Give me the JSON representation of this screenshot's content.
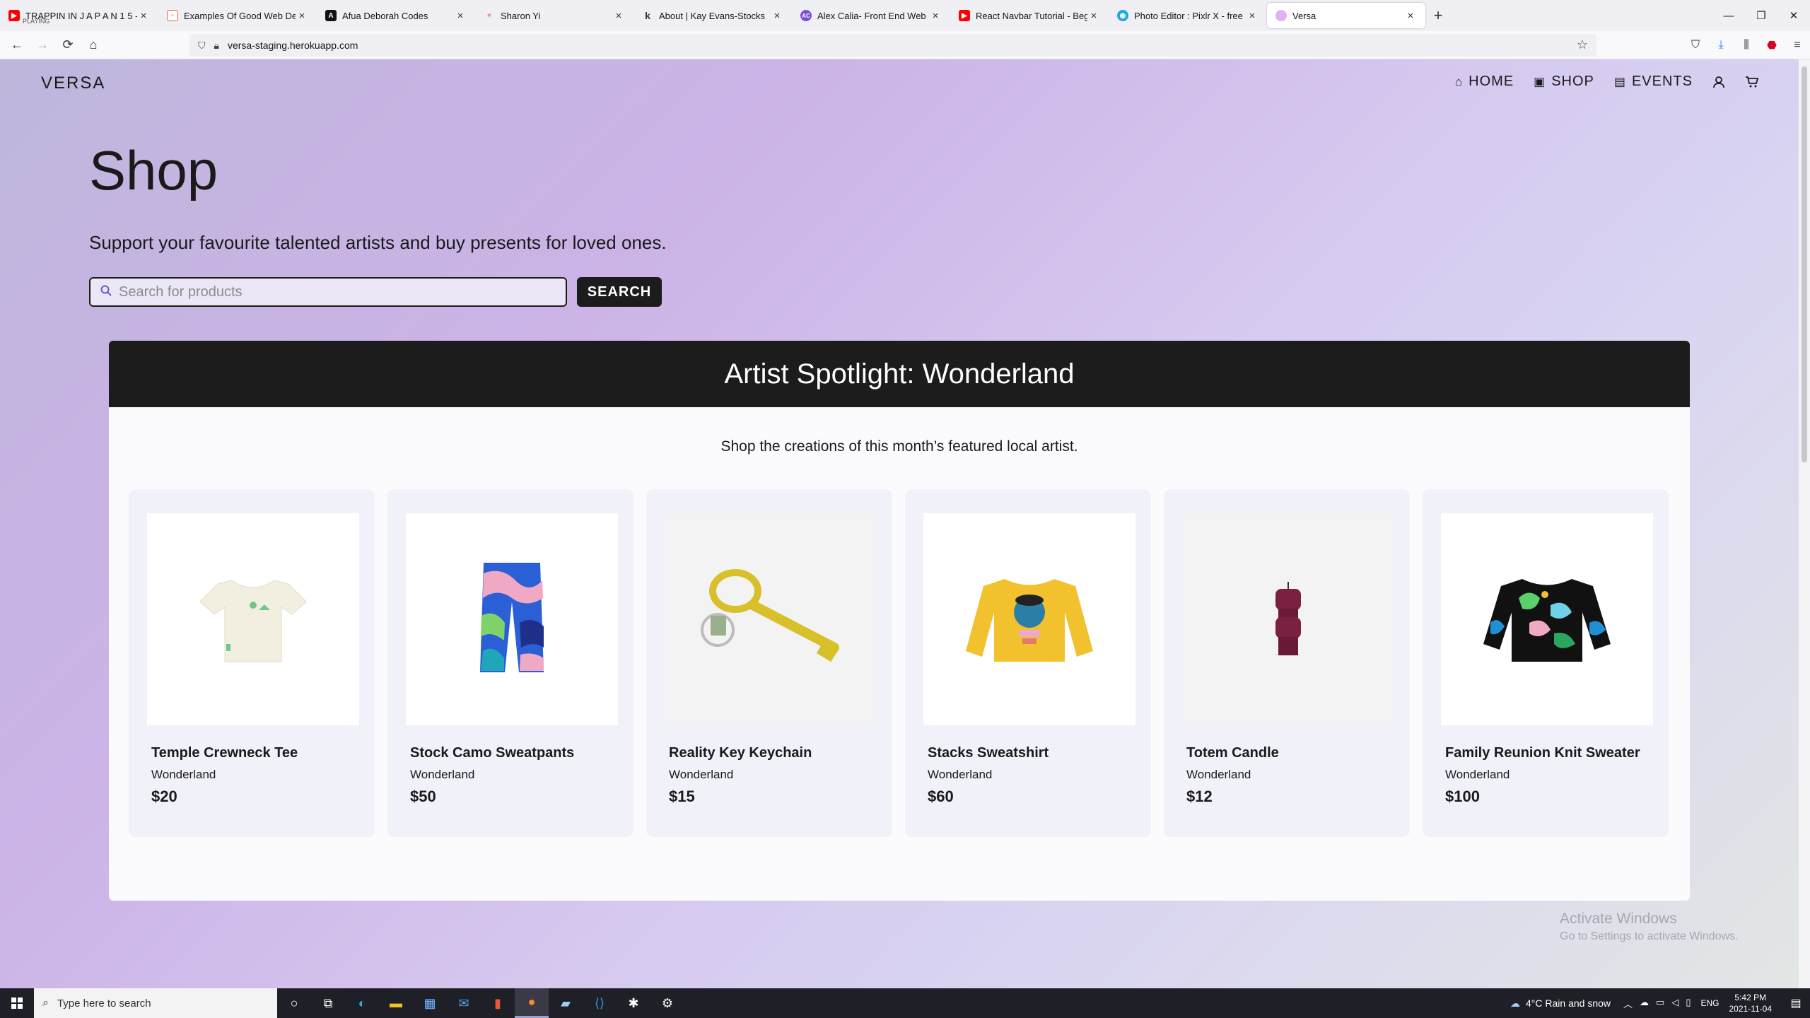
{
  "browser": {
    "tabs": [
      {
        "label": "TRAPPIN IN J A P A N 1 5 -",
        "sub": "PLAYING",
        "fav_color": "#ff0000",
        "fav_icon": "youtube-icon"
      },
      {
        "label": "Examples Of Good Web Develo",
        "fav_color": "#e8673a",
        "fav_icon": "page-icon"
      },
      {
        "label": "Afua Deborah Codes",
        "fav_color": "#111111",
        "fav_icon": "a-icon"
      },
      {
        "label": "Sharon Yi",
        "fav_color": "#f2b7c8",
        "fav_icon": "heart-icon"
      },
      {
        "label": "About | Kay Evans-Stocks",
        "fav_color": "#333333",
        "fav_icon": "k-icon"
      },
      {
        "label": "Alex Calia- Front End Web Deve",
        "fav_color": "#7a4fd6",
        "fav_icon": "ac-icon"
      },
      {
        "label": "React Navbar Tutorial - Beginne",
        "fav_color": "#ff0000",
        "fav_icon": "youtube-icon"
      },
      {
        "label": "Photo Editor : Pixlr X - free imag",
        "fav_color": "#1da7e0",
        "fav_icon": "pixlr-icon"
      },
      {
        "label": "Versa",
        "fav_color": "#e0b3f0",
        "fav_icon": "versa-icon"
      }
    ],
    "url": "versa-staging.herokuapp.com"
  },
  "site": {
    "logo": "VERSA",
    "nav": [
      {
        "label": "HOME",
        "icon": "home-icon"
      },
      {
        "label": "SHOP",
        "icon": "shop-icon"
      },
      {
        "label": "EVENTS",
        "icon": "calendar-icon"
      }
    ]
  },
  "shop": {
    "title": "Shop",
    "subtitle": "Support your favourite talented artists and buy presents for loved ones.",
    "search_placeholder": "Search for products",
    "search_button": "SEARCH"
  },
  "spotlight": {
    "title": "Artist Spotlight: Wonderland",
    "subtitle": "Shop the creations of this month’s featured local artist.",
    "products": [
      {
        "name": "Temple Crewneck Tee",
        "artist": "Wonderland",
        "price": "$20"
      },
      {
        "name": "Stock Camo Sweatpants",
        "artist": "Wonderland",
        "price": "$50"
      },
      {
        "name": "Reality Key Keychain",
        "artist": "Wonderland",
        "price": "$15"
      },
      {
        "name": "Stacks Sweatshirt",
        "artist": "Wonderland",
        "price": "$60"
      },
      {
        "name": "Totem Candle",
        "artist": "Wonderland",
        "price": "$12"
      },
      {
        "name": "Family Reunion Knit Sweater",
        "artist": "Wonderland",
        "price": "$100"
      }
    ]
  },
  "watermark": {
    "line1": "Activate Windows",
    "line2": "Go to Settings to activate Windows."
  },
  "taskbar": {
    "search_placeholder": "Type here to search",
    "weather": "4°C  Rain and snow",
    "lang": "ENG",
    "time": "5:42 PM",
    "date": "2021-11-04"
  }
}
